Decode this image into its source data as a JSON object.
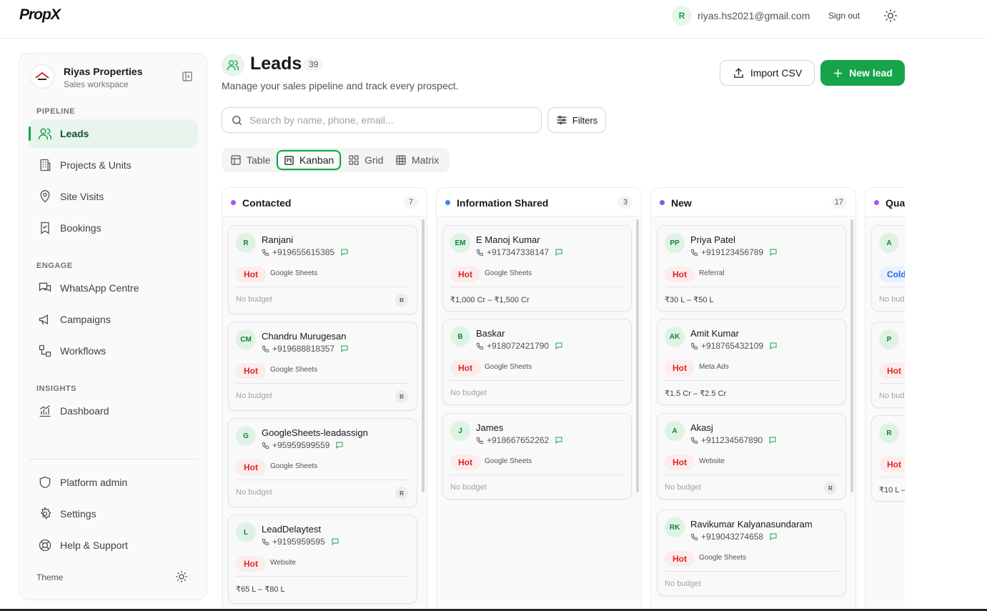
{
  "app": {
    "logo": "PropX"
  },
  "user": {
    "initial": "R",
    "email": "riyas.hs2021@gmail.com",
    "sign_out": "Sign out"
  },
  "workspace": {
    "name": "Riyas Properties",
    "subtitle": "Sales workspace"
  },
  "sidebar": {
    "sections": [
      {
        "label": "PIPELINE"
      },
      {
        "label": "ENGAGE"
      },
      {
        "label": "INSIGHTS"
      }
    ],
    "items": [
      {
        "label": "Leads",
        "icon": "users-icon",
        "active": true
      },
      {
        "label": "Projects & Units",
        "icon": "building-icon"
      },
      {
        "label": "Site Visits",
        "icon": "map-pin-icon"
      },
      {
        "label": "Bookings",
        "icon": "bookmark-check-icon"
      },
      {
        "label": "WhatsApp Centre",
        "icon": "chat-icon"
      },
      {
        "label": "Campaigns",
        "icon": "megaphone-icon"
      },
      {
        "label": "Workflows",
        "icon": "workflow-icon"
      },
      {
        "label": "Dashboard",
        "icon": "chart-icon"
      }
    ],
    "footer_items": [
      {
        "label": "Platform admin",
        "icon": "shield-icon"
      },
      {
        "label": "Settings",
        "icon": "gear-icon"
      },
      {
        "label": "Help & Support",
        "icon": "lifebuoy-icon"
      }
    ],
    "theme_label": "Theme"
  },
  "page": {
    "title": "Leads",
    "count": "39",
    "subtitle": "Manage your sales pipeline and track every prospect.",
    "import_label": "Import CSV",
    "new_label": "New lead",
    "search_placeholder": "Search by name, phone, email...",
    "filters_label": "Filters",
    "view_tabs": [
      {
        "label": "Table",
        "icon": "table-icon"
      },
      {
        "label": "Kanban",
        "icon": "kanban-icon",
        "active": true
      },
      {
        "label": "Grid",
        "icon": "grid-icon"
      },
      {
        "label": "Matrix",
        "icon": "matrix-icon"
      }
    ]
  },
  "colors": {
    "accent": "#16a34a",
    "hot": "#dc2626",
    "cold": "#2563eb"
  },
  "columns": [
    {
      "title": "Contacted",
      "count": "7",
      "dot": "#a855f7",
      "cards": [
        {
          "initials": "R",
          "name": "Ranjani",
          "phone": "+919655615385",
          "tag": "Hot",
          "source": "Google Sheets",
          "budget": "No budget",
          "assignee": "R"
        },
        {
          "initials": "CM",
          "name": "Chandru Murugesan",
          "phone": "+919688818357",
          "tag": "Hot",
          "source": "Google Sheets",
          "budget": "No budget",
          "assignee": "R"
        },
        {
          "initials": "G",
          "name": "GoogleSheets-leadassign",
          "phone": "+95959599559",
          "tag": "Hot",
          "source": "Google Sheets",
          "budget": "No budget",
          "assignee": "R"
        },
        {
          "initials": "L",
          "name": "LeadDelaytest",
          "phone": "+9195959595",
          "tag": "Hot",
          "source": "Website",
          "budget": "₹65 L – ₹80 L",
          "assignee": ""
        }
      ]
    },
    {
      "title": "Information Shared",
      "count": "3",
      "dot": "#3b82f6",
      "cards": [
        {
          "initials": "EM",
          "name": "E Manoj Kumar",
          "phone": "+917347338147",
          "tag": "Hot",
          "source": "Google Sheets",
          "budget": "₹1,000 Cr – ₹1,500 Cr",
          "assignee": ""
        },
        {
          "initials": "B",
          "name": "Baskar",
          "phone": "+918072421790",
          "tag": "Hot",
          "source": "Google Sheets",
          "budget": "No budget",
          "assignee": ""
        },
        {
          "initials": "J",
          "name": "James",
          "phone": "+918667652262",
          "tag": "Hot",
          "source": "Google Sheets",
          "budget": "No budget",
          "assignee": ""
        }
      ]
    },
    {
      "title": "New",
      "count": "17",
      "dot": "#6366f1",
      "cards": [
        {
          "initials": "PP",
          "name": "Priya Patel",
          "phone": "+919123456789",
          "tag": "Hot",
          "source": "Referral",
          "budget": "₹30 L – ₹50 L",
          "assignee": ""
        },
        {
          "initials": "AK",
          "name": "Amit Kumar",
          "phone": "+918765432109",
          "tag": "Hot",
          "source": "Meta Ads",
          "budget": "₹1.5 Cr – ₹2.5 Cr",
          "assignee": ""
        },
        {
          "initials": "A",
          "name": "Akasj",
          "phone": "+911234567890",
          "tag": "Hot",
          "source": "Website",
          "budget": "No budget",
          "assignee": "R"
        },
        {
          "initials": "RK",
          "name": "Ravikumar Kalyanasundaram",
          "phone": "+919043274658",
          "tag": "Hot",
          "source": "Google Sheets",
          "budget": "No budget",
          "assignee": ""
        }
      ]
    },
    {
      "title": "Qua",
      "count": "",
      "dot": "#a855f7",
      "cards": [
        {
          "initials": "A",
          "name": "",
          "phone": "",
          "tag": "Cold",
          "source": "",
          "budget": "No bud",
          "assignee": ""
        },
        {
          "initials": "P",
          "name": "",
          "phone": "",
          "tag": "Hot",
          "source": "",
          "budget": "No bud",
          "assignee": ""
        },
        {
          "initials": "R",
          "name": "",
          "phone": "",
          "tag": "Hot",
          "source": "",
          "budget": "₹10 L –",
          "assignee": ""
        }
      ]
    }
  ]
}
